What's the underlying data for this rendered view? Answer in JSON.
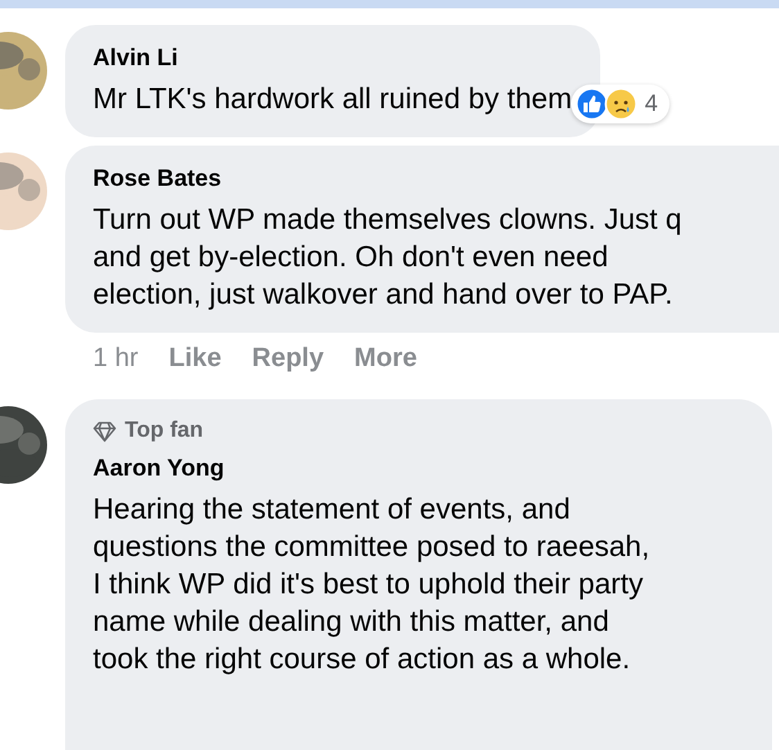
{
  "comments": [
    {
      "author": "Alvin Li",
      "text": "Mr LTK's hardwork all ruined by them",
      "reactions": [
        {
          "kind": "like"
        },
        {
          "kind": "sad"
        }
      ],
      "reaction_count": "4"
    },
    {
      "author": "Rose Bates",
      "text": "Turn out WP made themselves clowns. Just q\nand get by-election. Oh don't even need\nelection, just walkover and hand over to PAP.",
      "actions": {
        "time": "1 hr",
        "buttons": [
          "Like",
          "Reply",
          "More"
        ]
      }
    },
    {
      "badge": "Top fan",
      "author": "Aaron Yong",
      "text": "Hearing the statement of events, and\nquestions the committee posed to raeesah,\nI think WP did it's best to uphold their party\nname while dealing with this matter, and\ntook the right course of action as a whole."
    }
  ]
}
